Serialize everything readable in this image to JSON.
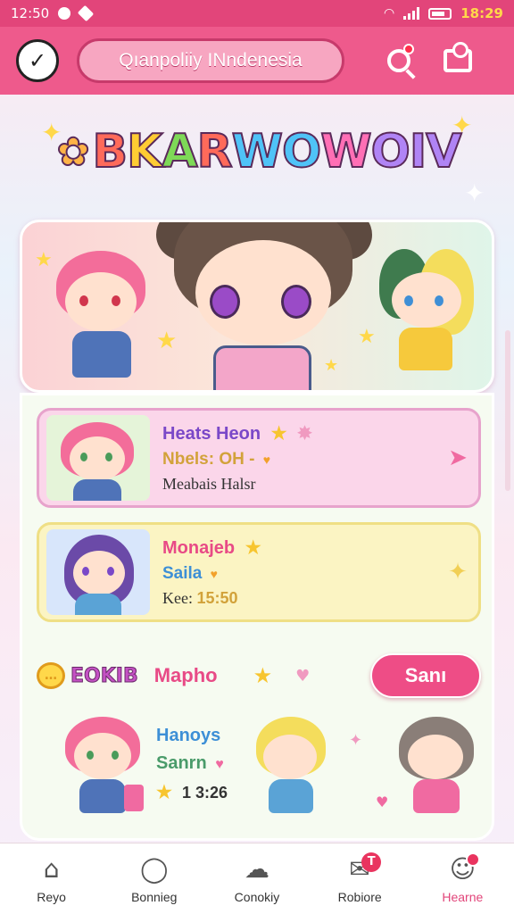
{
  "status_bar": {
    "time_left": "12:50",
    "time_right": "18:29"
  },
  "header": {
    "location_text": "Qıanpoliiy INndenesia",
    "icons": [
      "check-circle-icon",
      "search-icon",
      "profile-card-icon"
    ]
  },
  "banner": {
    "title_letters": [
      "B",
      "K",
      "A",
      "R",
      "W",
      "O",
      "W",
      "O",
      "I",
      "V"
    ]
  },
  "cards": [
    {
      "name": "Heats Heon",
      "subtitle": "Nbels: OH -",
      "meta": "Meabais Halsr"
    },
    {
      "name": "Monajeb",
      "subtitle": "Saila",
      "meta_label": "Kee:",
      "meta_value": "15:50"
    }
  ],
  "bottom_row": {
    "badge_text": "EOKIB",
    "label": "Mapho",
    "start_button": "Sanı"
  },
  "friends": {
    "line1": "Hanoys",
    "line2": "Sanrn",
    "line3": "1  3:26"
  },
  "nav": {
    "items": [
      {
        "label": "Reyo",
        "icon": "home-icon"
      },
      {
        "label": "Bonnieg",
        "icon": "chat-icon"
      },
      {
        "label": "Conokiy",
        "icon": "cloud-chat-icon"
      },
      {
        "label": "Robiore",
        "icon": "message-icon",
        "badge": "T"
      },
      {
        "label": "Hearne",
        "icon": "profile-icon",
        "active": true
      }
    ]
  },
  "colors": {
    "accent": "#ee5a8c",
    "status_bar": "#e2457a",
    "start_button": "#ee4d86"
  }
}
